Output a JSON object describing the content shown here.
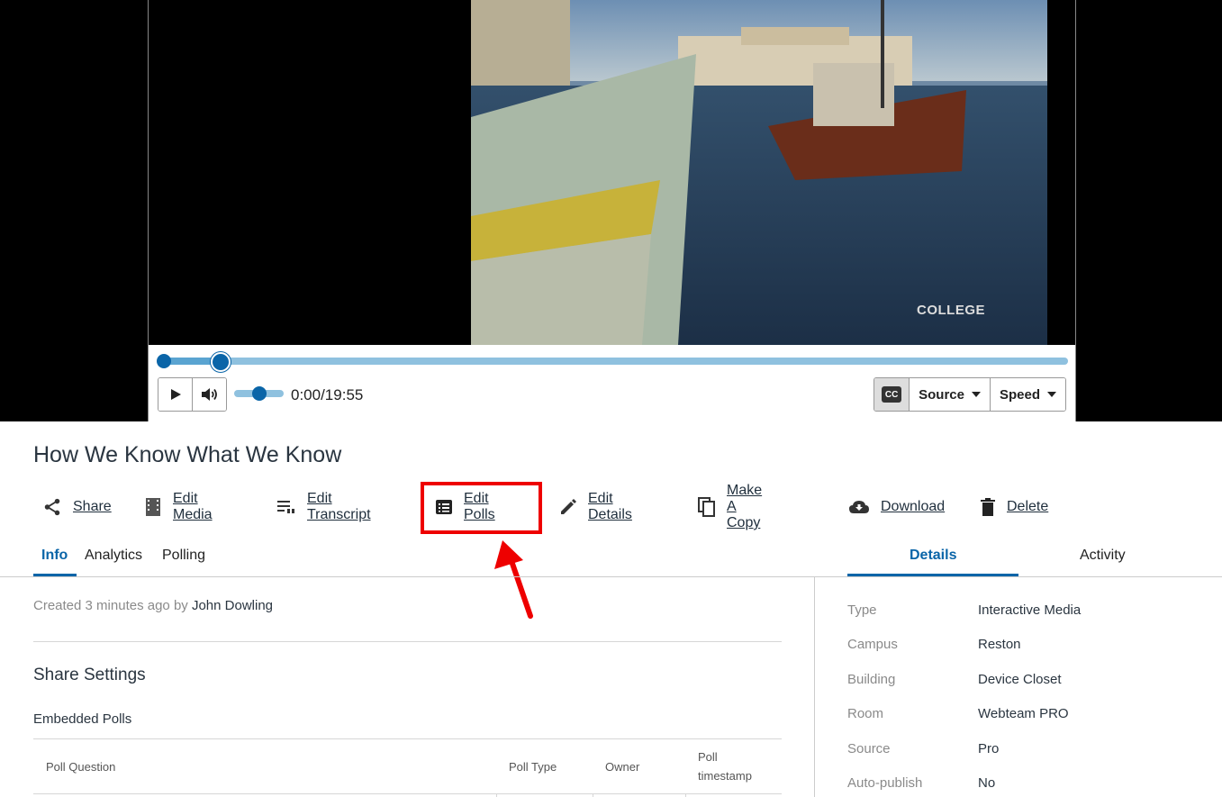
{
  "video": {
    "logo_text": "COLLEGE",
    "time": "0:00/19:55",
    "progress": 0.063,
    "volume": 0.5,
    "cc_label": "CC",
    "source_label": "Source",
    "speed_label": "Speed"
  },
  "media": {
    "title": "How We Know What We Know"
  },
  "actions": [
    {
      "label": "Share",
      "icon": "share-icon"
    },
    {
      "label": "Edit Media",
      "icon": "film-icon"
    },
    {
      "label": "Edit Transcript",
      "icon": "transcript-icon"
    },
    {
      "label": "Edit Polls",
      "icon": "poll-icon"
    },
    {
      "label": "Edit Details",
      "icon": "pencil-icon"
    },
    {
      "label": "Make A Copy",
      "icon": "copy-icon"
    },
    {
      "label": "Download",
      "icon": "cloud-download-icon"
    },
    {
      "label": "Delete",
      "icon": "trash-icon"
    }
  ],
  "tabs_left": [
    "Info",
    "Analytics",
    "Polling"
  ],
  "tabs_right": [
    "Details",
    "Activity"
  ],
  "info": {
    "created_prefix": "Created",
    "created_time": "3 minutes ago",
    "created_by": "by",
    "author": "John Dowling",
    "share_settings": "Share Settings",
    "embedded_polls": "Embedded Polls",
    "columns": [
      "Poll Question",
      "Poll Type",
      "Owner",
      "Poll timestamp"
    ]
  },
  "details": [
    {
      "label": "Type",
      "value": "Interactive Media"
    },
    {
      "label": "Campus",
      "value": "Reston"
    },
    {
      "label": "Building",
      "value": "Device Closet"
    },
    {
      "label": "Room",
      "value": "Webteam PRO"
    },
    {
      "label": "Source",
      "value": "Pro"
    },
    {
      "label": "Auto-publish",
      "value": "No"
    }
  ],
  "colors": {
    "accent": "#0a65a8",
    "highlight": "#e00000"
  }
}
